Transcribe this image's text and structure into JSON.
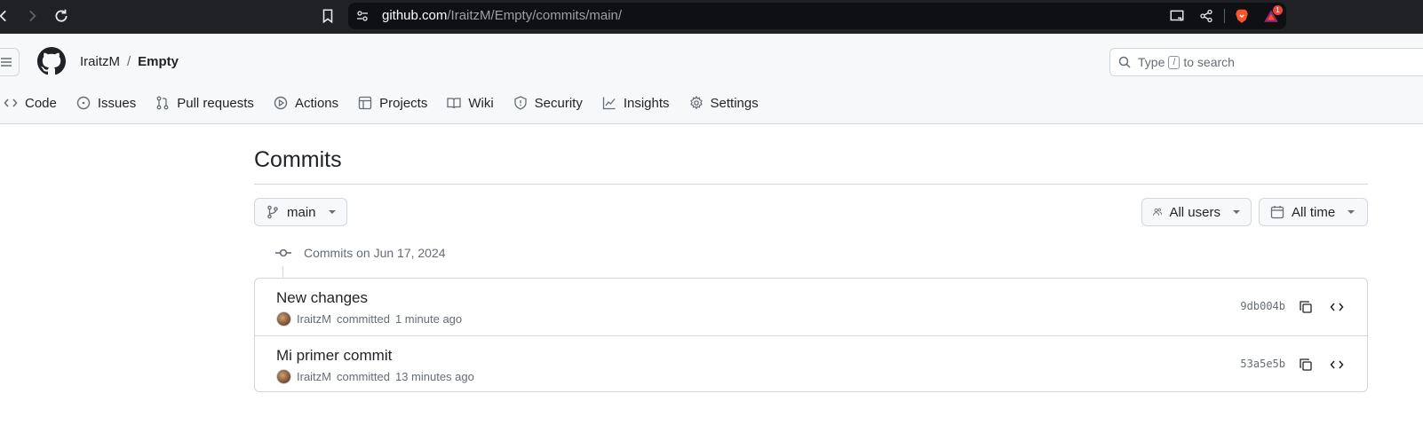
{
  "browser": {
    "url_host": "github.com",
    "url_path": "/IraitzM/Empty/commits/main/",
    "rewards_count": "1"
  },
  "header": {
    "owner": "IraitzM",
    "separator": "/",
    "repo": "Empty",
    "search": {
      "prefix": "Type",
      "key": "/",
      "suffix": "to search"
    }
  },
  "repo_nav": {
    "tabs": [
      {
        "label": "Code",
        "icon": "code-icon"
      },
      {
        "label": "Issues",
        "icon": "issue-icon"
      },
      {
        "label": "Pull requests",
        "icon": "pull-request-icon"
      },
      {
        "label": "Actions",
        "icon": "play-icon"
      },
      {
        "label": "Projects",
        "icon": "table-icon"
      },
      {
        "label": "Wiki",
        "icon": "book-icon"
      },
      {
        "label": "Security",
        "icon": "shield-icon"
      },
      {
        "label": "Insights",
        "icon": "graph-icon"
      },
      {
        "label": "Settings",
        "icon": "gear-icon"
      }
    ]
  },
  "main": {
    "title": "Commits",
    "branch": "main",
    "users_filter": "All users",
    "time_filter": "All time",
    "group_heading": "Commits on Jun 17, 2024",
    "commits": [
      {
        "title": "New changes",
        "author": "IraitzM",
        "verb": "committed",
        "time": "1 minute ago",
        "sha": "9db004b"
      },
      {
        "title": "Mi primer commit",
        "author": "IraitzM",
        "verb": "committed",
        "time": "13 minutes ago",
        "sha": "53a5e5b"
      }
    ]
  }
}
